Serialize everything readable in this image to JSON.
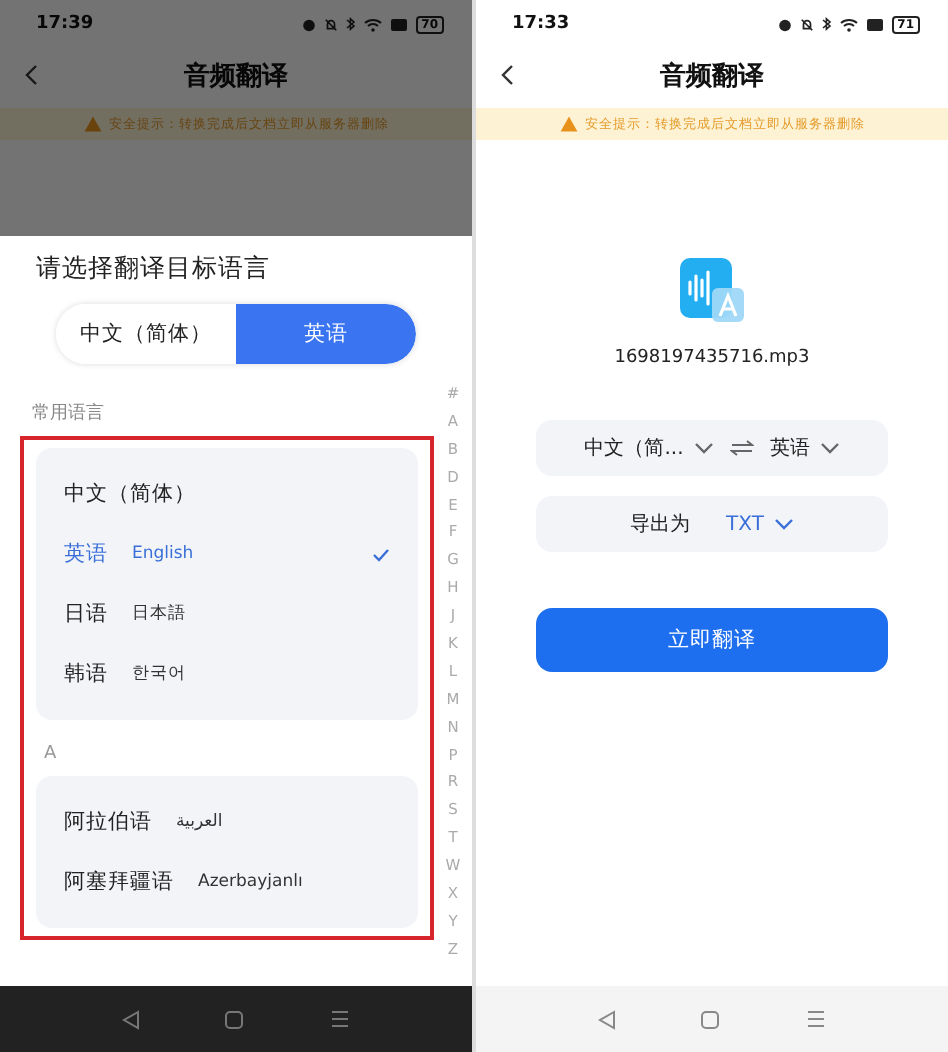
{
  "left_screen": {
    "status_bar": {
      "time": "17:39",
      "battery": "70"
    },
    "title": "音频翻译",
    "notice": "安全提示：转换完成后文档立即从服务器删除",
    "dimmed": true,
    "sheet": {
      "title": "请选择翻译目标语言",
      "segments": [
        {
          "label": "中文（简体）",
          "selected": false
        },
        {
          "label": "英语",
          "selected": true
        }
      ],
      "highlighted": true,
      "sections": [
        {
          "heading": "常用语言",
          "items": [
            {
              "name": "中文（简体）",
              "selected": false
            },
            {
              "name": "英语",
              "native": "English",
              "selected": true
            },
            {
              "name": "日语",
              "native": "日本語",
              "selected": false
            },
            {
              "name": "韩语",
              "native": "한국어",
              "selected": false
            }
          ]
        },
        {
          "heading": "A",
          "items": [
            {
              "name": "阿拉伯语",
              "native": "العربية",
              "selected": false
            },
            {
              "name": "阿塞拜疆语",
              "native": "Azerbayjanlı",
              "selected": false
            }
          ]
        }
      ],
      "index": [
        "#",
        "A",
        "B",
        "D",
        "E",
        "F",
        "G",
        "H",
        "J",
        "K",
        "L",
        "M",
        "N",
        "P",
        "R",
        "S",
        "T",
        "W",
        "X",
        "Y",
        "Z"
      ]
    }
  },
  "right_screen": {
    "status_bar": {
      "time": "17:33",
      "battery": "71"
    },
    "title": "音频翻译",
    "notice": "安全提示：转换完成后文档立即从服务器删除",
    "file_name": "1698197435716.mp3",
    "source_language": "中文（简...",
    "target_language": "英语",
    "export_label": "导出为",
    "export_format": "TXT",
    "action_button": "立即翻译"
  }
}
